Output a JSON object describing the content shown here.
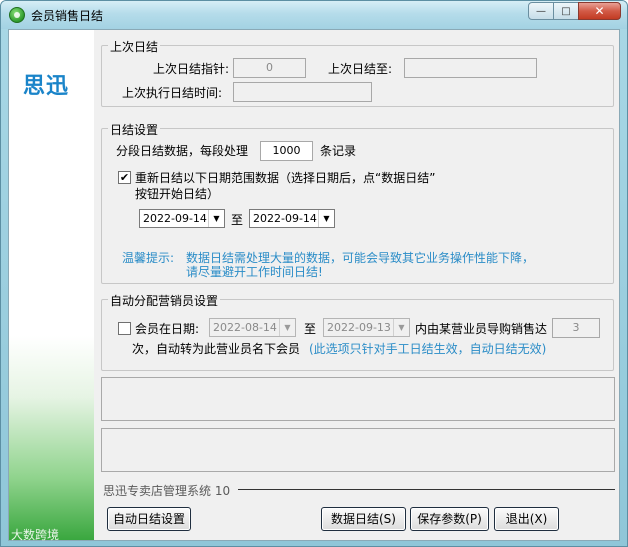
{
  "window": {
    "title": "会员销售日结",
    "close_glyph": "✕",
    "min_glyph": "—",
    "max_glyph": "□"
  },
  "sidebar": {
    "logo": "思迅",
    "watermark": "大数跨境"
  },
  "last_settle": {
    "group_title": "上次日结",
    "pointer_label": "上次日结指针:",
    "pointer_value": "0",
    "until_label": "上次日结至:",
    "until_value": "",
    "exec_time_label": "上次执行日结时间:",
    "exec_time_value": ""
  },
  "settings": {
    "group_title": "日结设置",
    "segment_label": "分段日结数据，每段处理",
    "segment_value": "1000",
    "segment_unit": "条记录",
    "resettle_checked": "✔",
    "resettle_text_1": "重新日结以下日期范围数据（选择日期后，点“数据日结”",
    "resettle_text_2": "按钮开始日结）",
    "date_from": "2022-09-14",
    "to_label": "至",
    "date_to": "2022-09-14",
    "tip_label": "温馨提示:",
    "tip_line_1": "数据日结需处理大量的数据，可能会导致其它业务操作性能下降，",
    "tip_line_2": "请尽量避开工作时间日结!"
  },
  "auto_assign": {
    "group_title": "自动分配营销员设置",
    "member_label": "会员在日期:",
    "date_from": "2022-08-14",
    "to_label": "至",
    "date_to": "2022-09-13",
    "within_label": "内由某营业员导购销售达",
    "count_value": "3",
    "line2_text": "次，自动转为此营业员名下会员",
    "line2_note": "(此选项只针对手工日结生效，自动日结无效)"
  },
  "footer": {
    "system_name": "思迅专卖店管理系统 10",
    "auto_settle_btn": "自动日结设置",
    "data_settle_btn": "数据日结(S)",
    "save_params_btn": "保存参数(P)",
    "exit_btn": "退出(X)"
  },
  "icons": {
    "dropdown": "▼"
  }
}
